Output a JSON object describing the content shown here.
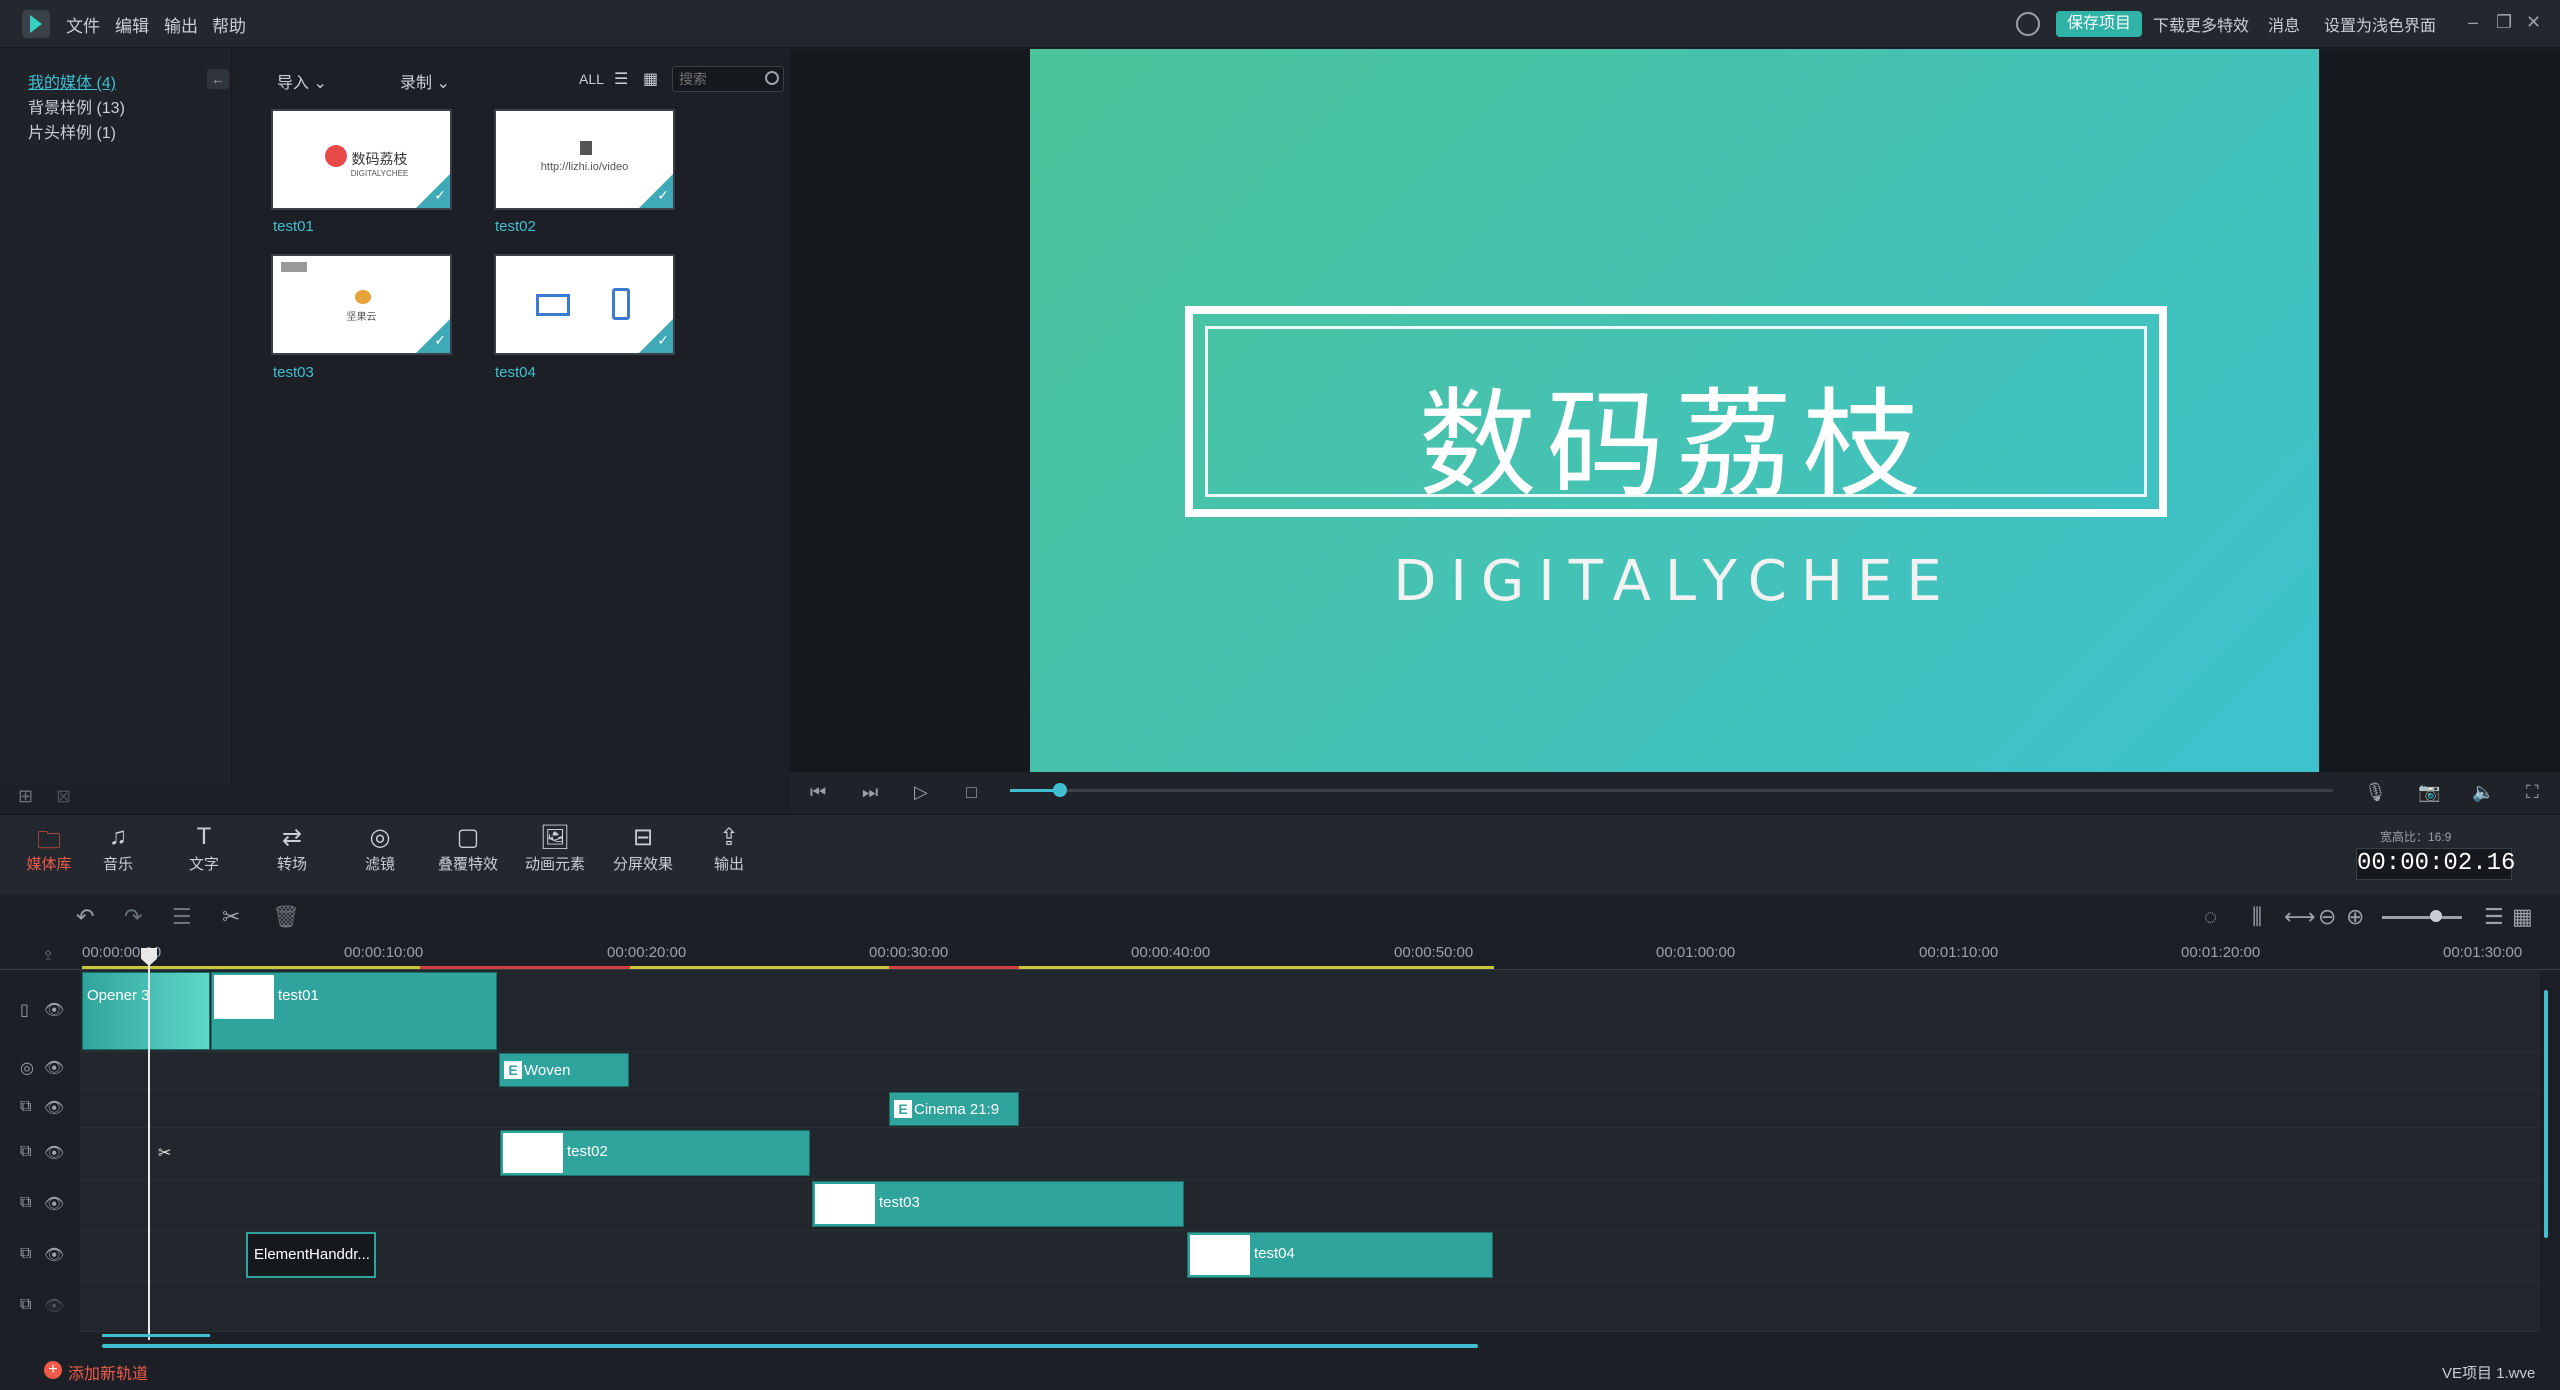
{
  "menu": {
    "file": "文件",
    "edit": "编辑",
    "export": "输出",
    "help": "帮助"
  },
  "titlebar": {
    "save": "保存项目",
    "download_effects": "下载更多特效",
    "messages": "消息",
    "theme": "设置为浅色界面"
  },
  "media_tree": {
    "items": [
      {
        "label": "我的媒体 (4)",
        "active": true
      },
      {
        "label": "背景样例 (13)",
        "active": false
      },
      {
        "label": "片头样例 (1)",
        "active": false
      }
    ]
  },
  "media_toolbar": {
    "import": "导入",
    "record": "录制",
    "all": "ALL",
    "search_placeholder": "搜索"
  },
  "media_items": [
    {
      "label": "test01",
      "thumb_text": "数码荔枝",
      "thumb_sub": "DIGITALYCHEE"
    },
    {
      "label": "test02",
      "thumb_text": "http://lizhi.io/video",
      "thumb_sub": ""
    },
    {
      "label": "test03",
      "thumb_text": "坚果云",
      "thumb_sub": ""
    },
    {
      "label": "test04",
      "thumb_text": "",
      "thumb_sub": ""
    }
  ],
  "preview": {
    "title": "数码荔枝",
    "subtitle": "DIGITALYCHEE"
  },
  "tools": [
    {
      "label": "媒体库",
      "icon": "folder-icon",
      "active": true
    },
    {
      "label": "音乐",
      "icon": "music-icon",
      "active": false
    },
    {
      "label": "文字",
      "icon": "text-icon",
      "active": false
    },
    {
      "label": "转场",
      "icon": "transition-icon",
      "active": false
    },
    {
      "label": "滤镜",
      "icon": "filter-icon",
      "active": false
    },
    {
      "label": "叠覆特效",
      "icon": "overlay-icon",
      "active": false
    },
    {
      "label": "动画元素",
      "icon": "element-icon",
      "active": false
    },
    {
      "label": "分屏效果",
      "icon": "splitscreen-icon",
      "active": false
    },
    {
      "label": "输出",
      "icon": "export-icon",
      "active": false
    }
  ],
  "timecode": "00:00:02.16",
  "aspect_ratio": "宽高比：16:9",
  "ruler": {
    "ticks": [
      "00:00:00:00",
      "00:00:10:00",
      "00:00:20:00",
      "00:00:30:00",
      "00:00:40:00",
      "00:00:50:00",
      "00:01:00:00",
      "00:01:10:00",
      "00:01:20:00",
      "00:01:30:00"
    ]
  },
  "clips": {
    "opener": "Opener 3",
    "test01": "test01",
    "woven": "Woven",
    "cinema": "Cinema 21:9",
    "test02": "test02",
    "test03": "test03",
    "element": "ElementHanddr...",
    "test04": "test04"
  },
  "status": {
    "add_track": "添加新轨道",
    "project": "VE项目 1.wve"
  },
  "colors": {
    "accent": "#2fb3a6",
    "active_tool": "#f05a4a",
    "clip": "#2fa49c"
  }
}
